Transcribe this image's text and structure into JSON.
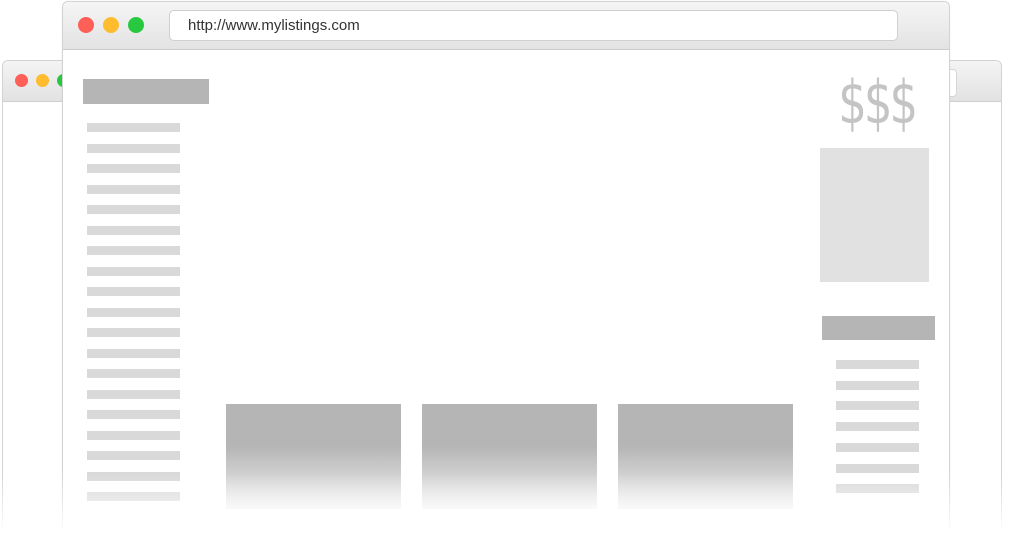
{
  "browser": {
    "url": "http://www.mylistings.com",
    "colors": {
      "close": "#fe5f57",
      "minimize": "#febc2e",
      "maximize": "#28c840"
    }
  },
  "sidebar": {
    "heading": "",
    "line_count": 19
  },
  "main": {
    "cards": [
      "",
      "",
      ""
    ]
  },
  "right_panel": {
    "price_symbol": "$$$",
    "line_count": 7
  }
}
